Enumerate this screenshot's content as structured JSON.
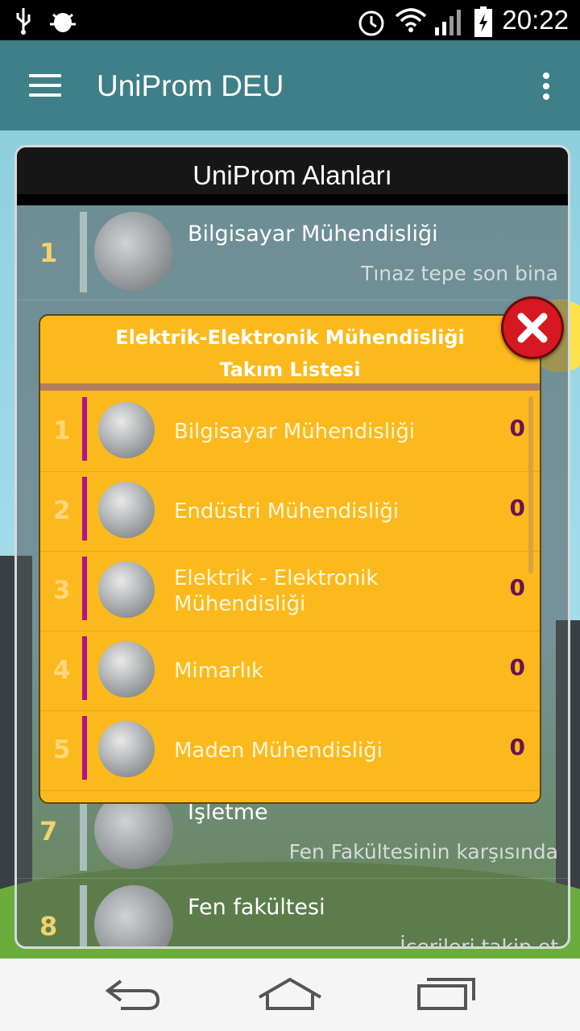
{
  "status_bar": {
    "time": "20:22"
  },
  "app_bar": {
    "title": "UniProm DEU"
  },
  "panel": {
    "title": "UniProm Alanları",
    "items": [
      {
        "num": "1",
        "name": "Bilgisayar Mühendisliği",
        "location": "Tınaz tepe son bina"
      },
      {
        "num": "7",
        "name": "İşletme",
        "location": "Fen Fakültesinin karşısında"
      },
      {
        "num": "8",
        "name": "Fen fakültesi",
        "location": "İçerileri takip et"
      }
    ]
  },
  "dialog": {
    "title_line1": "Elektrik-Elektronik Mühendisliği",
    "title_line2": "Takım Listesi",
    "rows": [
      {
        "num": "1",
        "name": "Bilgisayar Mühendisliği",
        "score": "0"
      },
      {
        "num": "2",
        "name": "Endüstri Mühendisliği",
        "score": "0"
      },
      {
        "num": "3",
        "name": "Elektrik - Elektronik Mühendisliği",
        "score": "0"
      },
      {
        "num": "4",
        "name": "Mimarlık",
        "score": "0"
      },
      {
        "num": "5",
        "name": "Maden Mühendisliği",
        "score": "0"
      }
    ]
  },
  "colors": {
    "app_bar": "#3e7f88",
    "dialog_bg": "#fbb91d",
    "accent_bar": "#b4128c",
    "score": "#6a1450",
    "close": "#d61822"
  }
}
